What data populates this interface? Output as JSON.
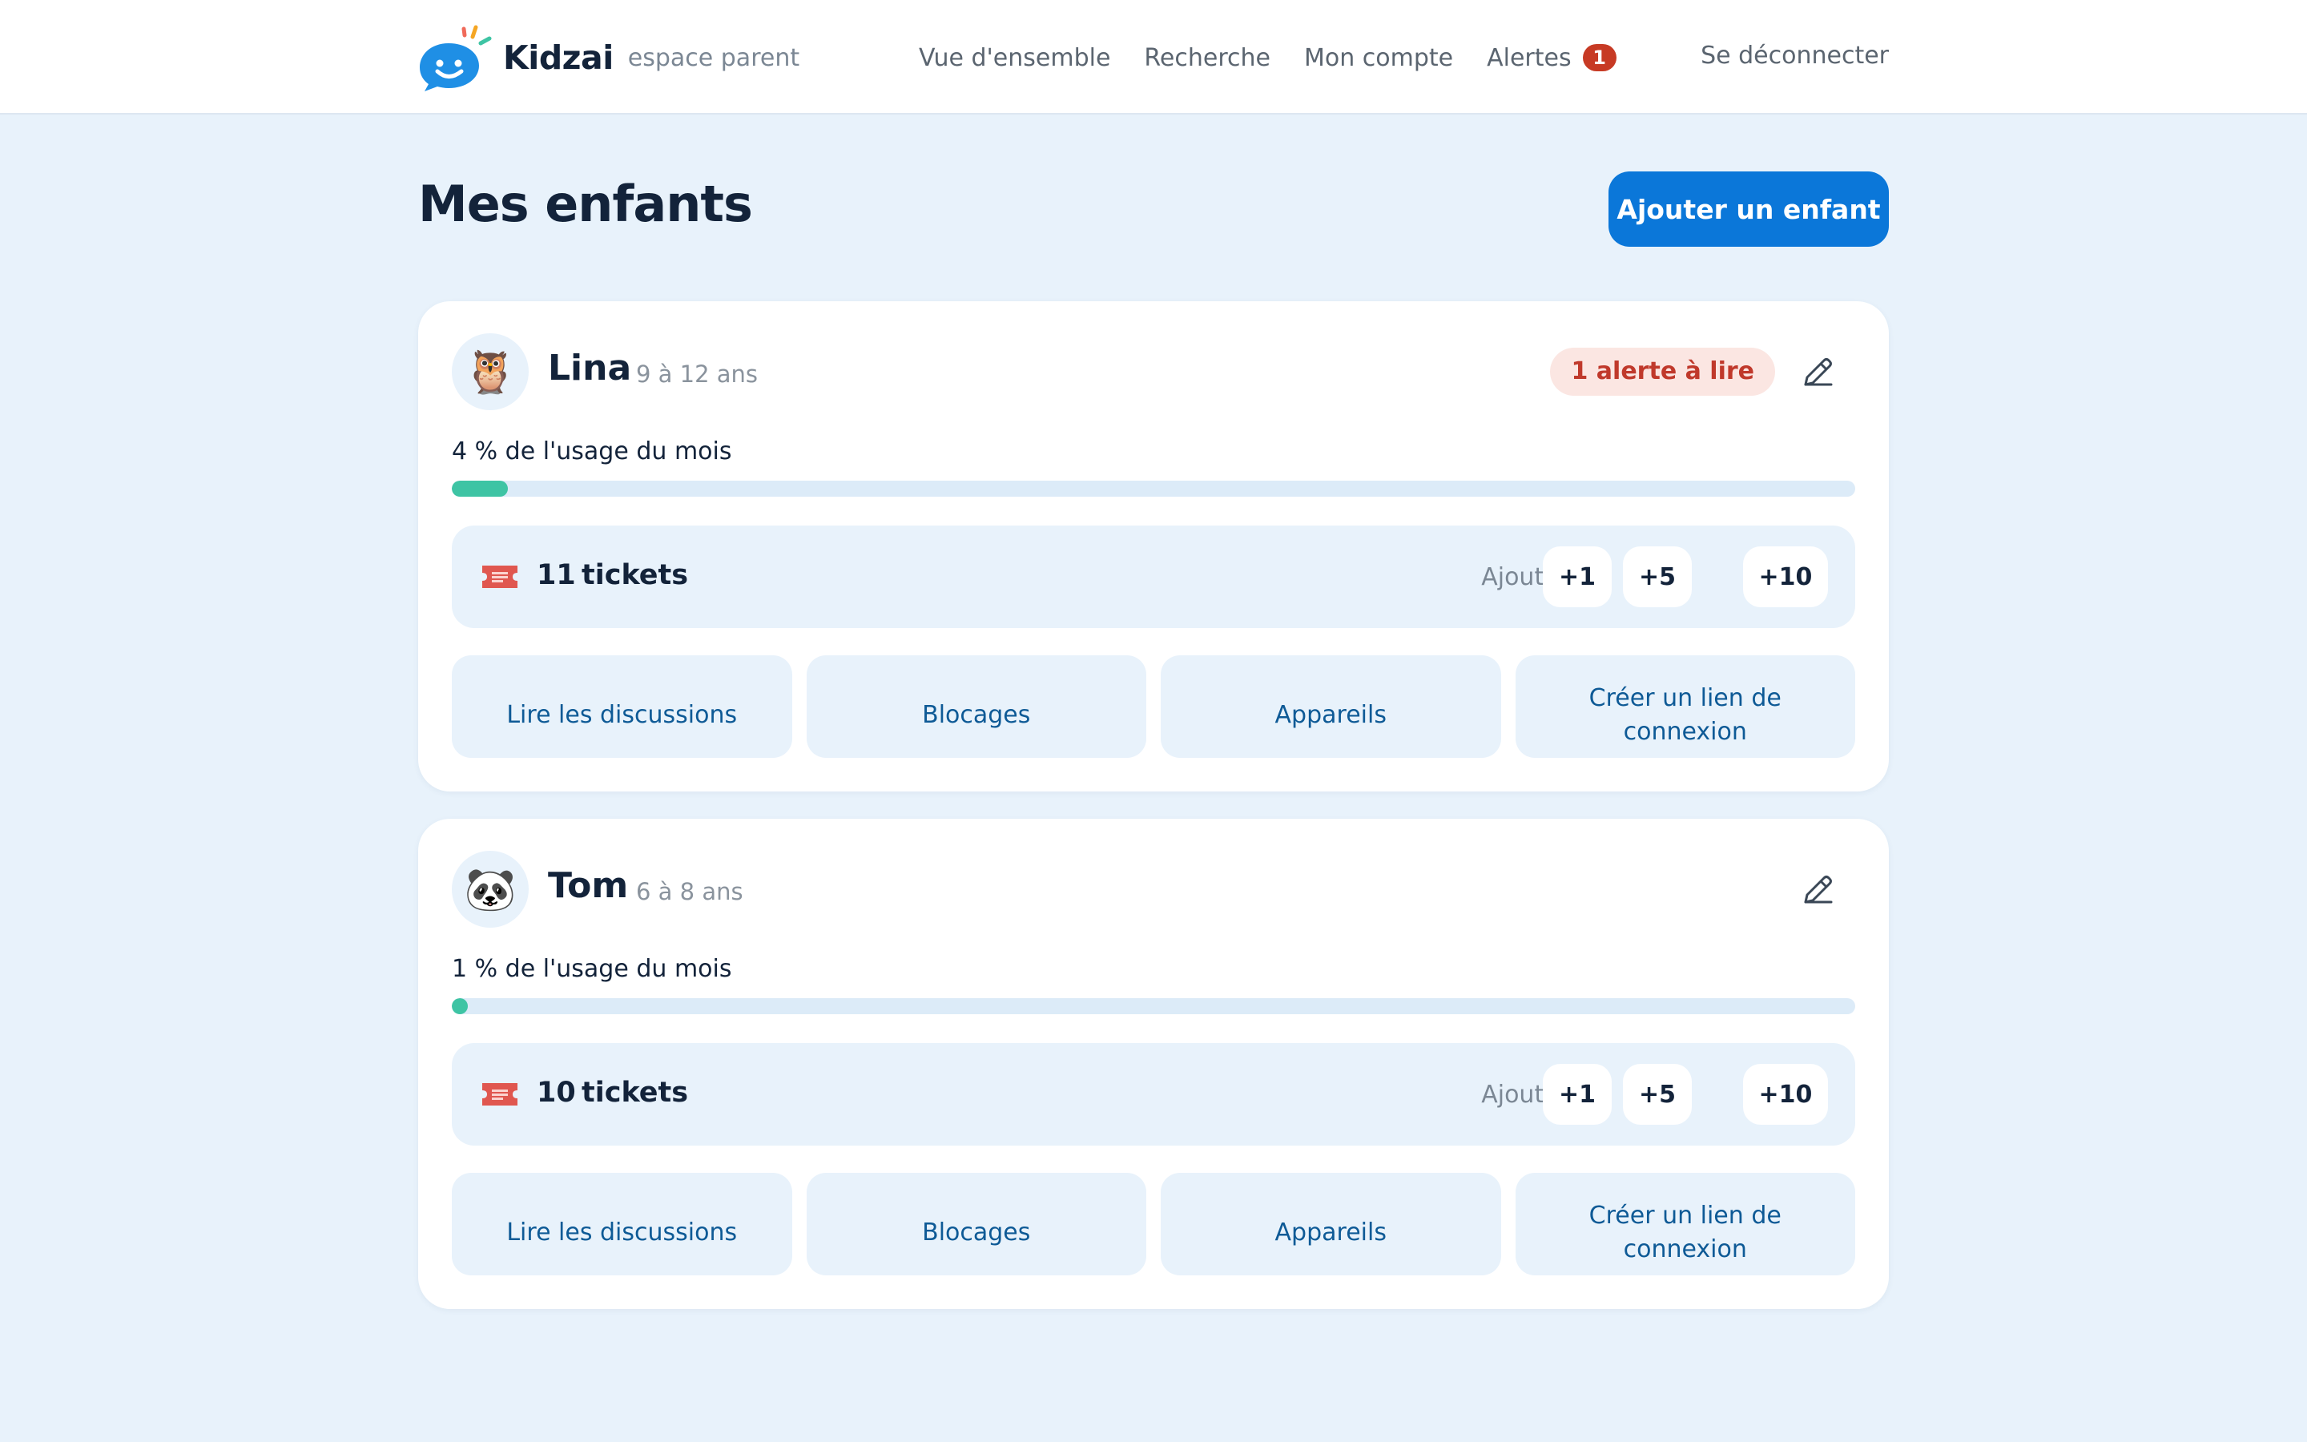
{
  "app": {
    "name": "Kidzai",
    "subtitle": "espace parent",
    "colors": {
      "accent": "#0b77d9",
      "alert": "#c73a24",
      "progress": "#3ec4a4",
      "background": "#e8f2fb"
    }
  },
  "nav": {
    "items": [
      {
        "label": "Vue d'ensemble"
      },
      {
        "label": "Recherche"
      },
      {
        "label": "Mon compte"
      },
      {
        "label": "Alertes",
        "badge": "1"
      }
    ],
    "logout": "Se déconnecter"
  },
  "page": {
    "title": "Mes enfants",
    "add_child_label": "Ajouter un enfant"
  },
  "children": [
    {
      "avatar_emoji": "🦉",
      "name": "Lina",
      "age": "9 à 12 ans",
      "alert": "1 alerte à lire",
      "usage_label": "4 % de l'usage du mois",
      "usage_percent": 4,
      "tickets_count": "11",
      "tickets_word": "tickets",
      "add_label": "Ajouter",
      "add_buttons": [
        "+1",
        "+5",
        "+10"
      ],
      "actions": [
        "Lire les discussions",
        "Blocages",
        "Appareils",
        "Créer un lien de connexion"
      ]
    },
    {
      "avatar_emoji": "🐼",
      "name": "Tom",
      "age": "6 à 8 ans",
      "alert": "",
      "usage_label": "1 % de l'usage du mois",
      "usage_percent": 1,
      "tickets_count": "10",
      "tickets_word": "tickets",
      "add_label": "Ajouter",
      "add_buttons": [
        "+1",
        "+5",
        "+10"
      ],
      "actions": [
        "Lire les discussions",
        "Blocages",
        "Appareils",
        "Créer un lien de connexion"
      ]
    }
  ]
}
